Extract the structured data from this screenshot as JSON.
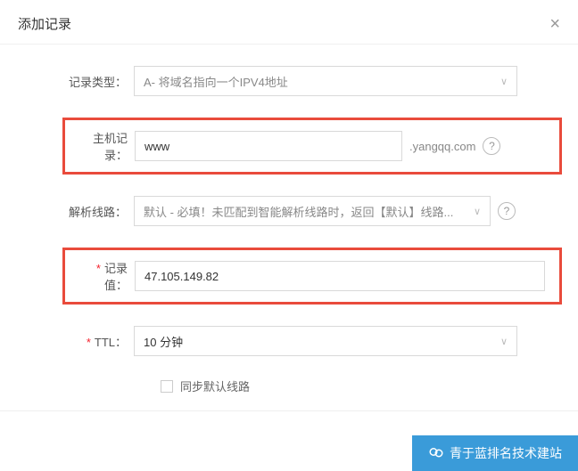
{
  "modal": {
    "title": "添加记录",
    "close_label": "×"
  },
  "fields": {
    "record_type": {
      "label": "记录类型：",
      "value": "A- 将域名指向一个IPV4地址"
    },
    "host_record": {
      "label": "主机记录：",
      "value": "www",
      "suffix": ".yangqq.com"
    },
    "resolution_line": {
      "label": "解析线路：",
      "value": "默认 - 必填！未匹配到智能解析线路时，返回【默认】线路..."
    },
    "record_value": {
      "label": "记录值：",
      "value": "47.105.149.82"
    },
    "ttl": {
      "label": "TTL：",
      "value": "10 分钟"
    },
    "sync_default": {
      "label": "同步默认线路"
    }
  },
  "banner": {
    "text": "青于蓝排名技术建站"
  }
}
